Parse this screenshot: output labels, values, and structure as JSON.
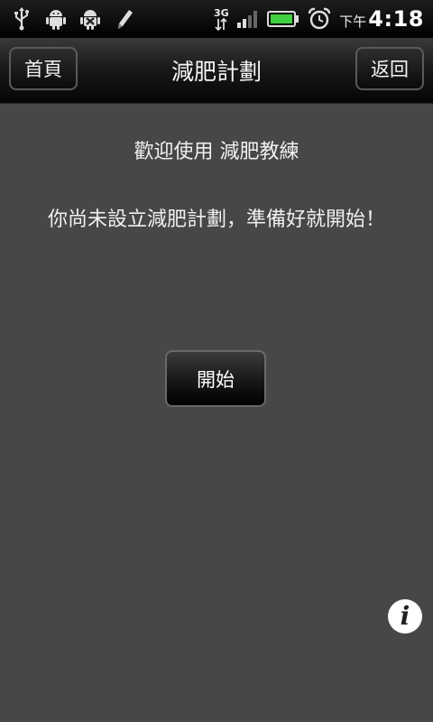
{
  "status_bar": {
    "icons": [
      "usb-icon",
      "android-debug-icon",
      "android-blocked-icon",
      "pencil-icon"
    ],
    "network_label": "3G",
    "signal_icon": "signal-bars-icon",
    "battery_icon": "battery-icon",
    "alarm_icon": "alarm-clock-icon",
    "clock_period": "下午",
    "clock_time": "4:18"
  },
  "title_bar": {
    "home_label": "首頁",
    "title": "減肥計劃",
    "back_label": "返回"
  },
  "main": {
    "welcome_text": "歡迎使用 減肥教練",
    "notice_text": "你尚未設立減肥計劃，準備好就開始！",
    "start_label": "開始",
    "info_icon": "info-icon",
    "info_glyph": "i"
  },
  "colors": {
    "background": "#474747",
    "battery_fill": "#3fd13f"
  }
}
